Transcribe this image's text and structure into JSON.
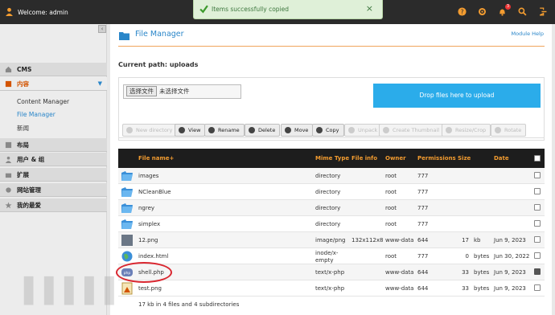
{
  "topbar": {
    "welcome": "Welcome: admin",
    "notifications_count": "3"
  },
  "toast": {
    "message": "Items successfully copied",
    "close": "×"
  },
  "sidebar": {
    "sections": [
      {
        "label": "CMS"
      },
      {
        "label": "内容",
        "active": true
      },
      {
        "label": "布局"
      },
      {
        "label": "用户 & 组"
      },
      {
        "label": "扩展"
      },
      {
        "label": "网站管理"
      },
      {
        "label": "我的最爱"
      }
    ],
    "content_items": [
      "Content Manager",
      "File Manager",
      "新闻"
    ]
  },
  "main": {
    "title": "File Manager",
    "module_help": "Module Help",
    "current_path": "Current path: uploads",
    "choose_file_button": "选择文件",
    "no_file_chosen": "未选择文件",
    "dropzone": "Drop files here to upload"
  },
  "toolbar": [
    {
      "label": "New directory",
      "enabled": false
    },
    {
      "label": "View",
      "enabled": true
    },
    {
      "label": "Rename",
      "enabled": true
    },
    {
      "label": "Delete",
      "enabled": true
    },
    {
      "label": "Move",
      "enabled": true
    },
    {
      "label": "Copy",
      "enabled": true
    },
    {
      "label": "Unpack",
      "enabled": false
    },
    {
      "label": "Create Thumbnail",
      "enabled": false
    },
    {
      "label": "Resize/Crop",
      "enabled": false
    },
    {
      "label": "Rotate",
      "enabled": false
    }
  ],
  "table": {
    "headers": {
      "name": "File name+",
      "mime": "Mime Type",
      "info": "File info",
      "owner": "Owner",
      "perm": "Permissions",
      "size": "Size",
      "date": "Date"
    },
    "rows": [
      {
        "icon": "folder-icon",
        "name": "images",
        "mime": "directory",
        "info": "",
        "owner": "root",
        "perm": "777",
        "size": "",
        "unit": "",
        "date": "",
        "checked": false
      },
      {
        "icon": "folder-icon",
        "name": "NCleanBlue",
        "mime": "directory",
        "info": "",
        "owner": "root",
        "perm": "777",
        "size": "",
        "unit": "",
        "date": "",
        "checked": false
      },
      {
        "icon": "folder-icon",
        "name": "ngrey",
        "mime": "directory",
        "info": "",
        "owner": "root",
        "perm": "777",
        "size": "",
        "unit": "",
        "date": "",
        "checked": false
      },
      {
        "icon": "folder-icon",
        "name": "simplex",
        "mime": "directory",
        "info": "",
        "owner": "root",
        "perm": "777",
        "size": "",
        "unit": "",
        "date": "",
        "checked": false
      },
      {
        "icon": "image-thumb-icon",
        "name": "12.png",
        "mime": "image/png",
        "info": "132x112x8",
        "owner": "www-data",
        "perm": "644",
        "size": "17",
        "unit": "kb",
        "date": "Jun  9, 2023",
        "checked": false
      },
      {
        "icon": "globe-icon",
        "name": "index.html",
        "mime": "inode/x-empty",
        "info": "",
        "owner": "root",
        "perm": "777",
        "size": "0",
        "unit": "bytes",
        "date": "Jun 30, 2022",
        "checked": false
      },
      {
        "icon": "php-file-icon",
        "name": "shell.php",
        "mime": "text/x-php",
        "info": "",
        "owner": "www-data",
        "perm": "644",
        "size": "33",
        "unit": "bytes",
        "date": "Jun  9, 2023",
        "checked": true
      },
      {
        "icon": "image-file-icon",
        "name": "test.png",
        "mime": "text/x-php",
        "info": "",
        "owner": "www-data",
        "perm": "644",
        "size": "33",
        "unit": "bytes",
        "date": "Jun  9, 2023",
        "checked": false
      }
    ],
    "summary": "17 kb in 4 files and 4 subdirectories"
  },
  "colors": {
    "accent": "#2a86c9",
    "orange": "#f39c30",
    "dropzone": "#2bacea",
    "topbar": "#2b2b2b"
  }
}
